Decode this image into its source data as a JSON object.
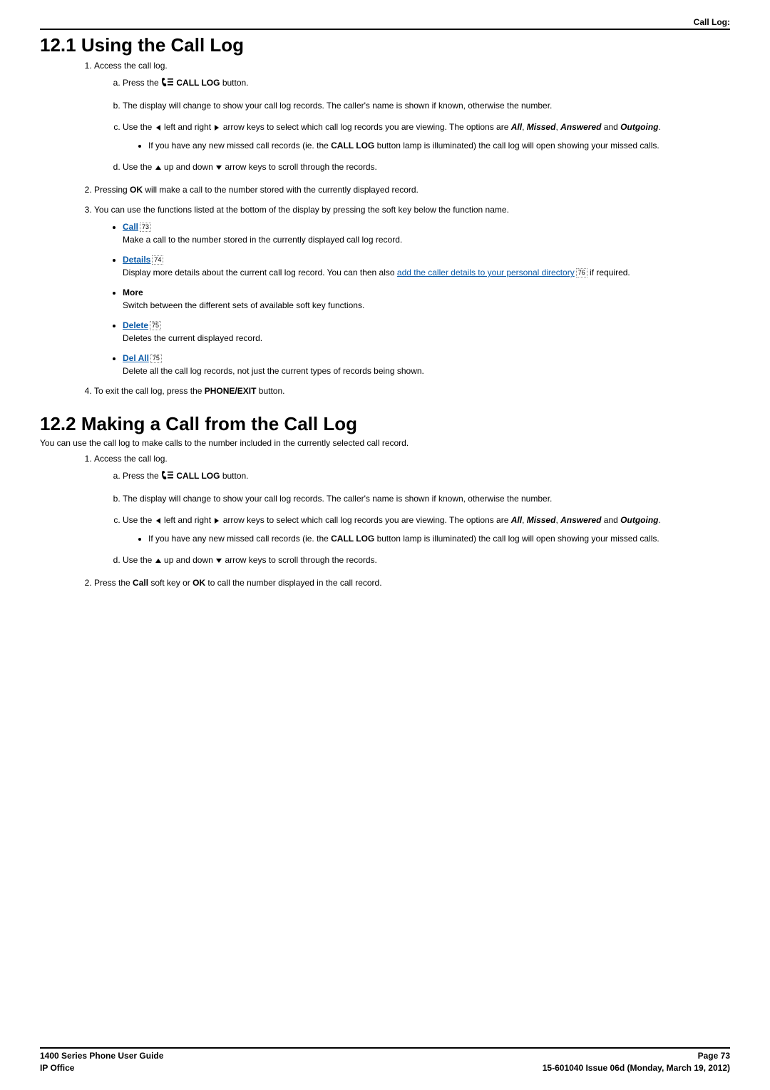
{
  "header": {
    "section_label": "Call Log:"
  },
  "s1": {
    "heading": "12.1 Using the Call Log",
    "n1": "Access the call log.",
    "a_pre": "Press the ",
    "a_btn": " CALL LOG",
    "a_post": " button.",
    "b": "The display will change to show your call log records. The caller's name is shown if known, otherwise the number.",
    "c_pre": "Use the ",
    "c_mid1": " left and right ",
    "c_mid2": " arrow keys to select which call log records you are viewing. The options are ",
    "opt_all": "All",
    "comma1": ", ",
    "opt_missed": "Missed",
    "comma2": ", ",
    "opt_answered": "Answered",
    "and": " and ",
    "opt_outgoing": "Outgoing",
    "period": ".",
    "c_sub_pre": "If you have any new missed call records (ie. the ",
    "c_sub_btn": "CALL LOG",
    "c_sub_post": " button lamp is illuminated) the call log will open showing your missed calls.",
    "d_pre": "Use the ",
    "d_mid1": " up and down ",
    "d_post": " arrow keys to scroll through the records.",
    "n2_pre": "Pressing ",
    "n2_ok": "OK",
    "n2_post": " will make a call to the number stored with the currently displayed record.",
    "n3": "You can use the functions listed at the bottom of the display by pressing the soft key below the function name.",
    "fn_call": "Call",
    "fn_call_ref": "73",
    "fn_call_desc": "Make a call to the number stored in the currently displayed call log record.",
    "fn_details": "Details",
    "fn_details_ref": "74",
    "fn_details_desc_pre": "Display more details about the current call log record. You can then also ",
    "fn_details_link": "add the caller details to your personal directory",
    "fn_details_link_ref": "76",
    "fn_details_desc_post": " if required.",
    "fn_more": "More",
    "fn_more_desc": "Switch between the different sets of available soft key functions.",
    "fn_delete": "Delete",
    "fn_delete_ref": "75",
    "fn_delete_desc": "Deletes the current displayed record.",
    "fn_delall": "Del All",
    "fn_delall_ref": "75",
    "fn_delall_desc": "Delete all the call log records, not just the current types of records being shown.",
    "n4_pre": "To exit the call log, press the ",
    "n4_btn": "PHONE/EXIT",
    "n4_post": " button."
  },
  "s2": {
    "heading": "12.2 Making a Call from the Call Log",
    "intro": "You can use the call log to make calls to the number included in the currently selected call record.",
    "n2_pre": "Press the ",
    "n2_call": "Call",
    "n2_mid": " soft key or ",
    "n2_ok": "OK",
    "n2_post": " to call the number displayed in the call record."
  },
  "footer": {
    "l1": "1400 Series Phone User Guide",
    "l2": "IP Office",
    "r1": "Page 73",
    "r2": "15-601040 Issue 06d (Monday, March 19, 2012)"
  }
}
